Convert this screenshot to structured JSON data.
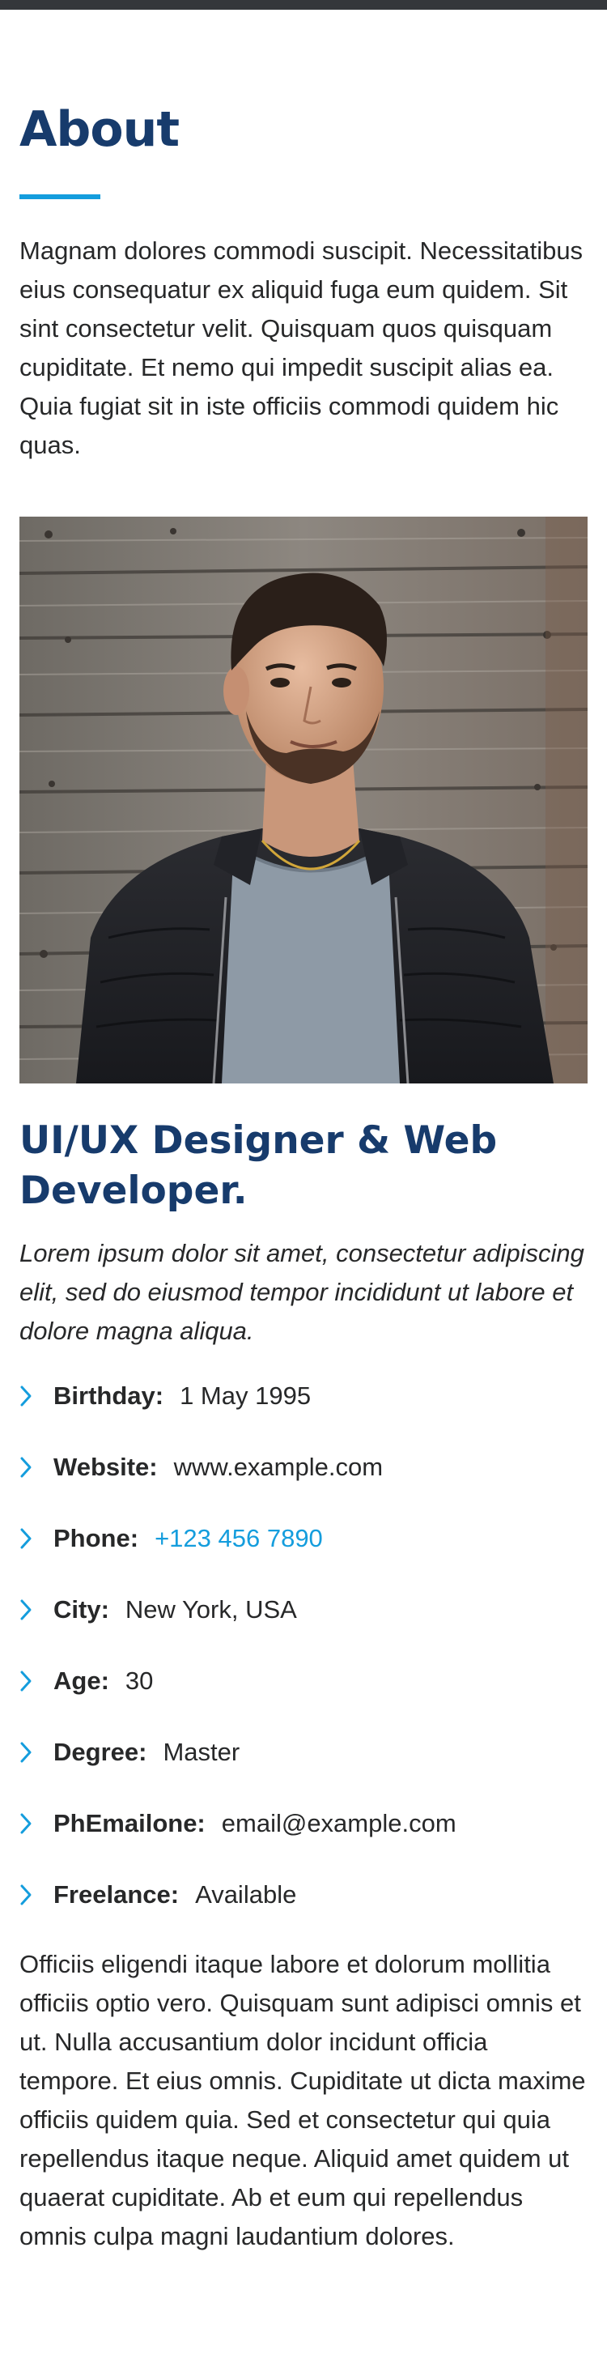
{
  "about": {
    "title": "About",
    "intro": "Magnam dolores commodi suscipit. Necessitatibus eius consequatur ex aliquid fuga eum quidem. Sit sint consectetur velit. Quisquam quos quisquam cupiditate. Et nemo qui impedit suscipit alias ea. Quia fugiat sit in iste officiis commodi quidem hic quas.",
    "role_title": "UI/UX Designer & Web Developer.",
    "role_subtitle": "Lorem ipsum dolor sit amet, consectetur adipiscing elit, sed do eiusmod tempor incididunt ut labore et dolore magna aliqua.",
    "details": [
      {
        "label": "Birthday:",
        "value": "1 May 1995"
      },
      {
        "label": "Website:",
        "value": "www.example.com"
      },
      {
        "label": "Phone:",
        "value": "+123 456 7890"
      },
      {
        "label": "City:",
        "value": "New York, USA"
      },
      {
        "label": "Age:",
        "value": "30"
      },
      {
        "label": "Degree:",
        "value": "Master"
      },
      {
        "label": "PhEmailone:",
        "value": "email@example.com"
      },
      {
        "label": "Freelance:",
        "value": "Available"
      }
    ],
    "outro": "Officiis eligendi itaque labore et dolorum mollitia officiis optio vero. Quisquam sunt adipisci omnis et ut. Nulla accusantium dolor incidunt officia tempore. Et eius omnis. Cupiditate ut dicta maxime officiis quidem quia. Sed et consectetur qui quia repellendus itaque neque. Aliquid amet quidem ut quaerat cupiditate. Ab et eum qui repellendus omnis culpa magni laudantium dolores."
  },
  "colors": {
    "heading": "#173b6c",
    "accent": "#149ddd",
    "text": "#272829"
  },
  "icons": {
    "detail_bullet": "chevron-right-icon"
  }
}
